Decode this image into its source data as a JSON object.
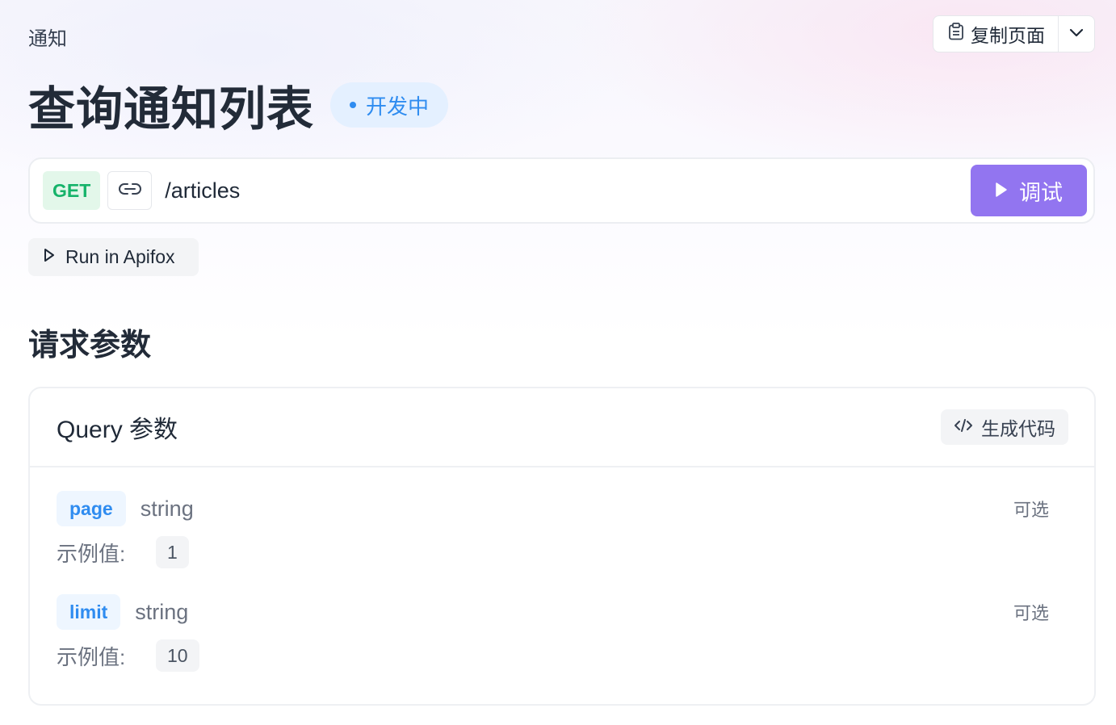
{
  "breadcrumb": "通知",
  "copy_page_label": "复制页面",
  "title": "查询通知列表",
  "status": "开发中",
  "endpoint": {
    "method": "GET",
    "path": "/articles",
    "debug_label": "调试"
  },
  "run_label": "Run in Apifox",
  "section_title": "请求参数",
  "query_card": {
    "title": "Query 参数",
    "gen_code_label": "生成代码",
    "params": [
      {
        "name": "page",
        "type": "string",
        "optional": "可选",
        "example_label": "示例值:",
        "example": "1"
      },
      {
        "name": "limit",
        "type": "string",
        "optional": "可选",
        "example_label": "示例值:",
        "example": "10"
      }
    ]
  },
  "colors": {
    "accent": "#9275f0",
    "get_method": "#16b36a",
    "status_blue": "#2f8cf0"
  },
  "icons": [
    "clipboard-icon",
    "chevron-down-icon",
    "link-icon",
    "play-icon",
    "play-outline-icon",
    "code-icon"
  ]
}
